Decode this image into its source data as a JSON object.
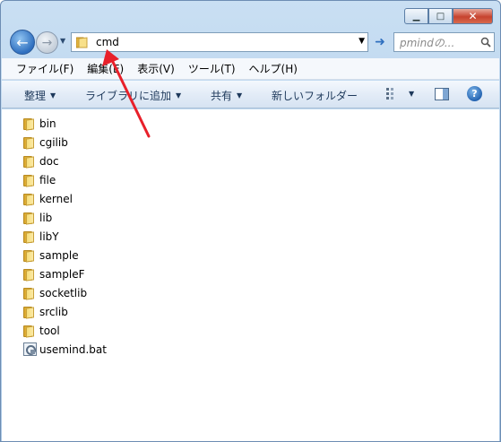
{
  "window": {
    "caption_buttons": [
      "minimize",
      "maximize",
      "close"
    ]
  },
  "navigation": {
    "back_icon": "back-arrow-icon",
    "forward_icon": "forward-arrow-icon",
    "address": "cmd",
    "search_placeholder": "pmindの..."
  },
  "menu": {
    "items": [
      "ファイル(F)",
      "編集(E)",
      "表示(V)",
      "ツール(T)",
      "ヘルプ(H)"
    ]
  },
  "commandbar": {
    "organize": "整理",
    "add_to_library": "ライブラリに追加",
    "share": "共有",
    "new_folder": "新しいフォルダー"
  },
  "files": [
    {
      "name": "bin",
      "type": "folder"
    },
    {
      "name": "cgilib",
      "type": "folder"
    },
    {
      "name": "doc",
      "type": "folder"
    },
    {
      "name": "file",
      "type": "folder"
    },
    {
      "name": "kernel",
      "type": "folder"
    },
    {
      "name": "lib",
      "type": "folder"
    },
    {
      "name": "libY",
      "type": "folder"
    },
    {
      "name": "sample",
      "type": "folder"
    },
    {
      "name": "sampleF",
      "type": "folder"
    },
    {
      "name": "socketlib",
      "type": "folder"
    },
    {
      "name": "srclib",
      "type": "folder"
    },
    {
      "name": "tool",
      "type": "folder"
    },
    {
      "name": "usemind.bat",
      "type": "batch"
    }
  ],
  "colors": {
    "annotation_arrow": "#e8202a",
    "folder": "#f2cf5a"
  }
}
